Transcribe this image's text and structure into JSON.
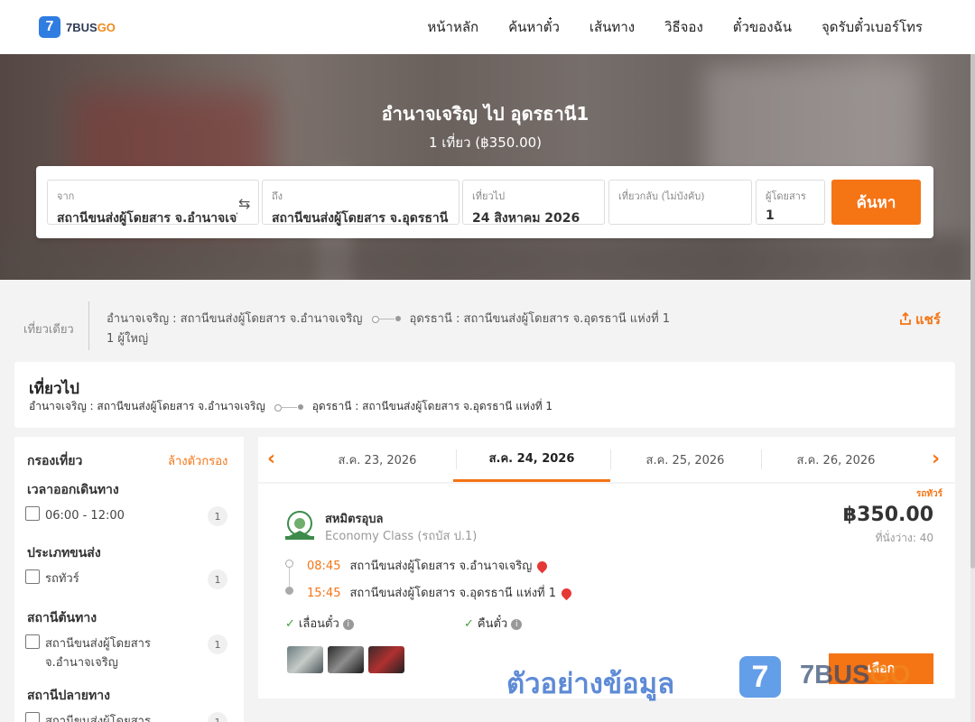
{
  "brand": {
    "logo_digit": "7",
    "logo_main": "7BUS",
    "logo_accent": "GO"
  },
  "nav": [
    "หน้าหลัก",
    "ค้นหาตั๋ว",
    "เส้นทาง",
    "วิธีจอง",
    "ตั๋วของฉัน",
    "จุดรับตั๋วเบอร์โทร"
  ],
  "hero": {
    "title": "อำนาจเจริญ ไป อุดรธานี1",
    "subtitle": "1 เที่ยว (฿350.00)"
  },
  "search": {
    "from_label": "จาก",
    "from_value": "สถานีขนส่งผู้โดยสาร จ.อำนาจเจริญ",
    "to_label": "ถึง",
    "to_value": "สถานีขนส่งผู้โดยสาร จ.อุดรธานี",
    "depart_label": "เที่ยวไป",
    "depart_value": "24 สิงหาคม 2026",
    "return_label": "เที่ยวกลับ (ไม่บังคับ)",
    "return_value": "",
    "pax_label": "ผู้โดยสาร",
    "pax_value": "1",
    "button": "ค้นหา"
  },
  "trip_summary": {
    "type": "เที่ยวเดียว",
    "origin": "อำนาจเจริญ : สถานีขนส่งผู้โดยสาร จ.อำนาจเจริญ",
    "destination": "อุดรธานี : สถานีขนส่งผู้โดยสาร จ.อุดรธานี แห่งที่ 1",
    "passengers": "1 ผู้ใหญ่",
    "share": "แชร์"
  },
  "outbound": {
    "title": "เที่ยวไป",
    "origin": "อำนาจเจริญ : สถานีขนส่งผู้โดยสาร จ.อำนาจเจริญ",
    "destination": "อุดรธานี : สถานีขนส่งผู้โดยสาร จ.อุดรธานี แห่งที่ 1"
  },
  "filters": {
    "title": "กรองเที่ยว",
    "clear": "ล้างตัวกรอง",
    "sections": [
      {
        "title": "เวลาออกเดินทาง",
        "options": [
          {
            "label": "06:00 - 12:00",
            "count": "1"
          }
        ]
      },
      {
        "title": "ประเภทขนส่ง",
        "options": [
          {
            "label": "รถทัวร์",
            "count": "1"
          }
        ]
      },
      {
        "title": "สถานีต้นทาง",
        "options": [
          {
            "label": "สถานีขนส่งผู้โดยสาร",
            "label2": "จ.อำนาจเจริญ",
            "count": "1"
          }
        ]
      },
      {
        "title": "สถานีปลายทาง",
        "options": [
          {
            "label": "สถานีขนส่งผู้โดยสาร",
            "count": "1"
          }
        ]
      }
    ]
  },
  "dates": [
    "ส.ค. 23, 2026",
    "ส.ค. 24, 2026",
    "ส.ค. 25, 2026",
    "ส.ค. 26, 2026"
  ],
  "active_date_index": 1,
  "result": {
    "tag": "รถทัวร์",
    "operator": "สหมิตรอุบล",
    "class": "Economy Class (รถบัส ป.1)",
    "price": "฿350.00",
    "seats": "ที่นั่งว่าง: 40",
    "depart_time": "08:45",
    "depart_station": "สถานีขนส่งผู้โดยสาร จ.อำนาจเจริญ",
    "arrive_time": "15:45",
    "arrive_station": "สถานีขนส่งผู้โดยสาร จ.อุดรธานี แห่งที่ 1",
    "feature1": "เลื่อนตั๋ว",
    "feature2": "คืนตั๋ว",
    "select": "เลือก"
  },
  "watermark": {
    "text": "ตัวอย่างข้อมูล",
    "logo_digit": "7",
    "brand_main": "7BUS",
    "brand_accent": "GO"
  },
  "colors": {
    "accent": "#f57414",
    "brand_blue": "#2f7de1"
  }
}
